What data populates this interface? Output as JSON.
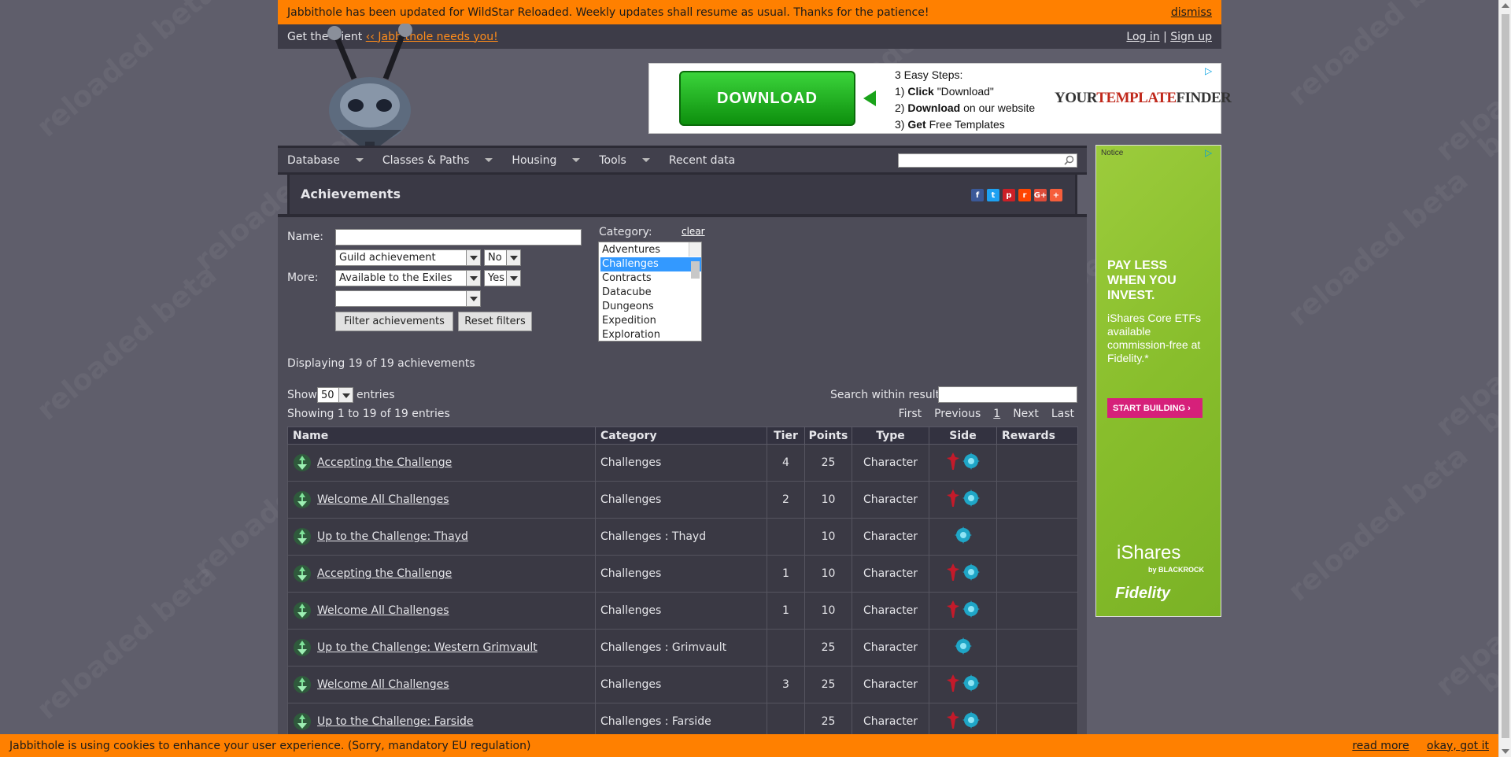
{
  "notice": {
    "text": "Jabbithole has been updated for WildStar Reloaded. Weekly updates shall resume as usual. Thanks for the patience!",
    "dismiss": "dismiss"
  },
  "subbar": {
    "get_client": "Get the client",
    "needs_you": "‹‹ Jabbithole needs you!",
    "login": "Log in",
    "sep": "|",
    "signup": "Sign up"
  },
  "watermark": "reloaded beta",
  "ad_top": {
    "button": "DOWNLOAD",
    "steps_title": "3 Easy Steps:",
    "step1_num": "1)",
    "step1_b": "Click",
    "step1_rest": "\"Download\"",
    "step2_num": "2)",
    "step2_b": "Download",
    "step2_rest": "on our website",
    "step3_num": "3)",
    "step3_b": "Get",
    "step3_rest": "Free Templates",
    "brand_a": "YOUR",
    "brand_b": "TEMPLATE",
    "brand_c": "FINDER"
  },
  "nav": {
    "items": [
      "Database",
      "Classes & Paths",
      "Housing",
      "Tools",
      "Recent data"
    ]
  },
  "ad_right": {
    "notice": "Notice",
    "headline": "PAY LESS WHEN YOU INVEST.",
    "body": "iShares Core ETFs available commission-free at Fidelity.*",
    "cta": "START BUILDING",
    "brand": "iShares",
    "by": "by BLACKROCK",
    "fidelity": "Fidelity"
  },
  "page": {
    "title": "Achievements",
    "share": [
      "f",
      "t",
      "p",
      "r",
      "G+",
      "+"
    ]
  },
  "filters": {
    "name_label": "Name:",
    "name_value": "",
    "more_label": "More:",
    "sel1": "Guild achievement",
    "sel1b": "No",
    "sel2": "Available to the Exiles",
    "sel2b": "Yes",
    "sel3": "",
    "filter_btn": "Filter achievements",
    "reset_btn": "Reset filters",
    "category_label": "Category:",
    "clear": "clear",
    "categories": [
      "Adventures",
      "Challenges",
      "Contracts",
      "Datacube",
      "Dungeons",
      "Expedition",
      "Exploration"
    ],
    "selected_category": "Challenges"
  },
  "results": {
    "displaying": "Displaying 19 of 19 achievements",
    "show": "Show",
    "entries_value": "50",
    "entries": "entries",
    "search_label": "Search within results:",
    "showing": "Showing 1 to 19 of 19 entries",
    "pager": {
      "first": "First",
      "prev": "Previous",
      "page": "1",
      "next": "Next",
      "last": "Last"
    }
  },
  "table": {
    "headers": [
      "Name",
      "Category",
      "Tier",
      "Points",
      "Type",
      "Side",
      "Rewards"
    ],
    "rows": [
      {
        "name": "Accepting the Challenge",
        "category": "Challenges",
        "tier": "4",
        "points": "25",
        "type": "Character",
        "side": "both",
        "rewards": ""
      },
      {
        "name": "Welcome All Challenges",
        "category": "Challenges",
        "tier": "2",
        "points": "10",
        "type": "Character",
        "side": "both",
        "rewards": ""
      },
      {
        "name": "Up to the Challenge: Thayd",
        "category": "Challenges : Thayd",
        "tier": "",
        "points": "10",
        "type": "Character",
        "side": "exile",
        "rewards": ""
      },
      {
        "name": "Accepting the Challenge",
        "category": "Challenges",
        "tier": "1",
        "points": "10",
        "type": "Character",
        "side": "both",
        "rewards": ""
      },
      {
        "name": "Welcome All Challenges",
        "category": "Challenges",
        "tier": "1",
        "points": "10",
        "type": "Character",
        "side": "both",
        "rewards": ""
      },
      {
        "name": "Up to the Challenge: Western Grimvault",
        "category": "Challenges : Grimvault",
        "tier": "",
        "points": "25",
        "type": "Character",
        "side": "exile",
        "rewards": ""
      },
      {
        "name": "Welcome All Challenges",
        "category": "Challenges",
        "tier": "3",
        "points": "25",
        "type": "Character",
        "side": "both",
        "rewards": ""
      },
      {
        "name": "Up to the Challenge: Farside",
        "category": "Challenges : Farside",
        "tier": "",
        "points": "25",
        "type": "Character",
        "side": "both",
        "rewards": ""
      }
    ]
  },
  "cookie": {
    "text": "Jabbithole is using cookies to enhance your user experience. (Sorry, mandatory EU regulation)",
    "read_more": "read more",
    "ok": "okay, got it"
  },
  "colors": {
    "accent": "#ff8000",
    "dominion": "#c41a2a",
    "exile": "#1fa6c7"
  },
  "icons": {
    "achievement": "achievement-icon",
    "dominion": "dominion-icon",
    "exile": "exile-icon",
    "search": "search-icon"
  }
}
